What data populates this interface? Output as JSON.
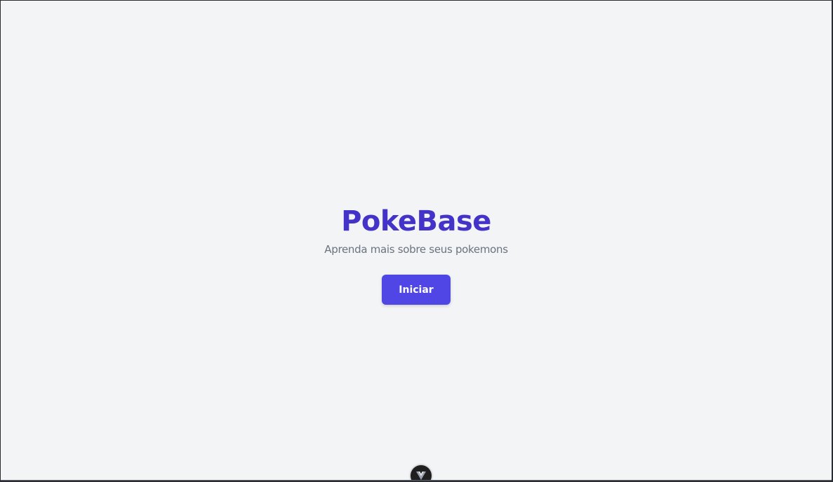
{
  "hero": {
    "title": "PokeBase",
    "subtitle": "Aprenda mais sobre seus pokemons",
    "start_label": "Iniciar"
  },
  "devtools": {
    "icon": "vue-logo-icon"
  },
  "colors": {
    "page_background": "#f3f4f6",
    "title": "#4433c8",
    "subtitle": "#6b7280",
    "button_background": "#4f46e5",
    "button_text": "#ffffff",
    "devtools_background": "#1f1f1f"
  }
}
